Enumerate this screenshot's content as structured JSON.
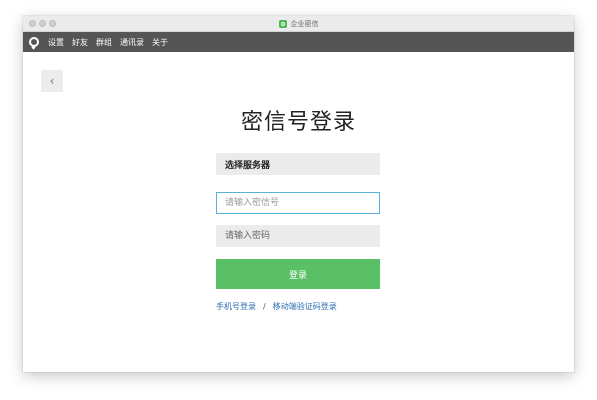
{
  "window": {
    "title": "企业密信",
    "accent": "#5ac065"
  },
  "menubar": {
    "logo_icon": "app-logo-icon",
    "items": [
      "设置",
      "好友",
      "群组",
      "通讯录",
      "关于"
    ]
  },
  "back": {
    "icon": "chevron-left-icon",
    "glyph": "‹"
  },
  "login": {
    "heading": "密信号登录",
    "server_label": "选择服务器",
    "id_placeholder": "请输入密信号",
    "password_placeholder": "请输入密码",
    "submit_label": "登录",
    "phone_link": "手机号登录",
    "separator": "/",
    "mobile_verify_link": "移动端验证码登录"
  }
}
